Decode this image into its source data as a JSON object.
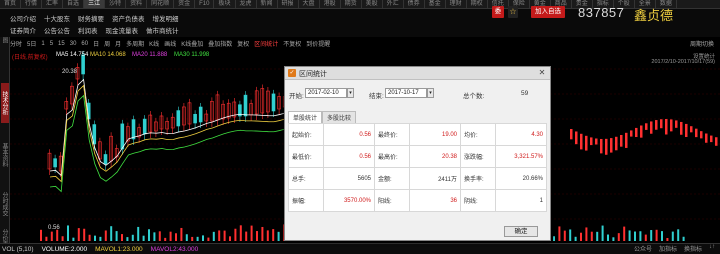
{
  "tabs": [
    "首页",
    "行情",
    "汇率",
    "自选",
    "三江",
    "沙特",
    "资料",
    "同花顺",
    "资金",
    "F10",
    "板块",
    "龙虎",
    "新闻",
    "研报",
    "大盘",
    "港股",
    "期货",
    "美股",
    "外汇",
    "债券",
    "基金",
    "理财",
    "期权",
    "信托",
    "保险",
    "黄金",
    "商品",
    "贵金",
    "指标",
    "个股",
    "全景",
    "数据"
  ],
  "active_tab_index": 4,
  "menu": {
    "row1": [
      "公司介绍",
      "十大股东",
      "财务摘要",
      "资产负债表",
      "增发明细"
    ],
    "row2": [
      "证券简介",
      "公告公告",
      "利润表",
      "现金流量表",
      "做市商统计"
    ]
  },
  "header": {
    "sq_label": "委",
    "star": "☆",
    "watch_label": "加入自选",
    "stock_code": "837857",
    "stock_name": "鑫贞德"
  },
  "toolbar": {
    "items": [
      "分时",
      "5日",
      "1",
      "5",
      "15",
      "30",
      "60",
      "日",
      "周",
      "月",
      "多周期",
      "K线",
      "画线",
      "K线叠加",
      "叠加指数",
      "复权",
      "区间统计",
      "不复权",
      "到价提醒"
    ],
    "active_index": 16,
    "right": "周期切换"
  },
  "left_tabs": {
    "items": [
      "分时图",
      "技术分析",
      "基本资料",
      "分时成交",
      "分价表"
    ],
    "active_index": 1
  },
  "chart_legend": {
    "title": "(日线,前复权)",
    "ma5": "MA5 14.754",
    "ma10": "MA10 14.068",
    "ma20": "MA20 11.888",
    "ma30": "MA30 11.998",
    "high_label": "20.38",
    "low_label": "0.56"
  },
  "right_info": {
    "line1": "设置统计",
    "line2": "2017/2/10-2017/10/17(59)"
  },
  "bottom_bar": {
    "vol": "VOL (5,10)",
    "volume": "VOLUME:2.000",
    "mavol1": "MAVOL1:23.000",
    "mavol2": "MAVOL2:43.000"
  },
  "bottom_right": [
    "公众号",
    "加指标",
    "换指标",
    "↓↑"
  ],
  "colors": {
    "red": "#d01a1a",
    "accent_red": "#c41a1a",
    "yellow": "#f0d040",
    "ma5": "#ffffff",
    "ma10": "#f0d040",
    "ma20": "#e040e0",
    "ma30": "#40e040"
  },
  "dialog": {
    "title": "区间统计",
    "start_label": "开始:",
    "start_date": "2017-02-10",
    "end_label": "结束:",
    "end_date": "2017-10-17",
    "total_label": "总个数:",
    "total_value": "59",
    "tab_single": "单股统计",
    "tab_multi": "多股比较",
    "rows": [
      [
        {
          "label": "起始价:",
          "value": "0.56",
          "color": "red"
        },
        {
          "label": "最终价:",
          "value": "19.00",
          "color": "red"
        },
        {
          "label": "均价:",
          "value": "4.30",
          "color": "red"
        }
      ],
      [
        {
          "label": "最低价:",
          "value": "0.56",
          "color": "red"
        },
        {
          "label": "最高价:",
          "value": "20.38",
          "color": "red"
        },
        {
          "label": "涨跌幅:",
          "value": "3,321.57%",
          "color": "red"
        }
      ],
      [
        {
          "label": "总手:",
          "value": "5605",
          "color": "blk"
        },
        {
          "label": "金额:",
          "value": "2411万",
          "color": "blk"
        },
        {
          "label": "换手率:",
          "value": "20.66%",
          "color": "blk"
        }
      ],
      [
        {
          "label": "振幅:",
          "value": "3570.00%",
          "color": "red"
        },
        {
          "label": "阳线:",
          "value": "36",
          "color": "red"
        },
        {
          "label": "阴线:",
          "value": "1",
          "color": "blk"
        }
      ]
    ],
    "ok_label": "确定"
  }
}
